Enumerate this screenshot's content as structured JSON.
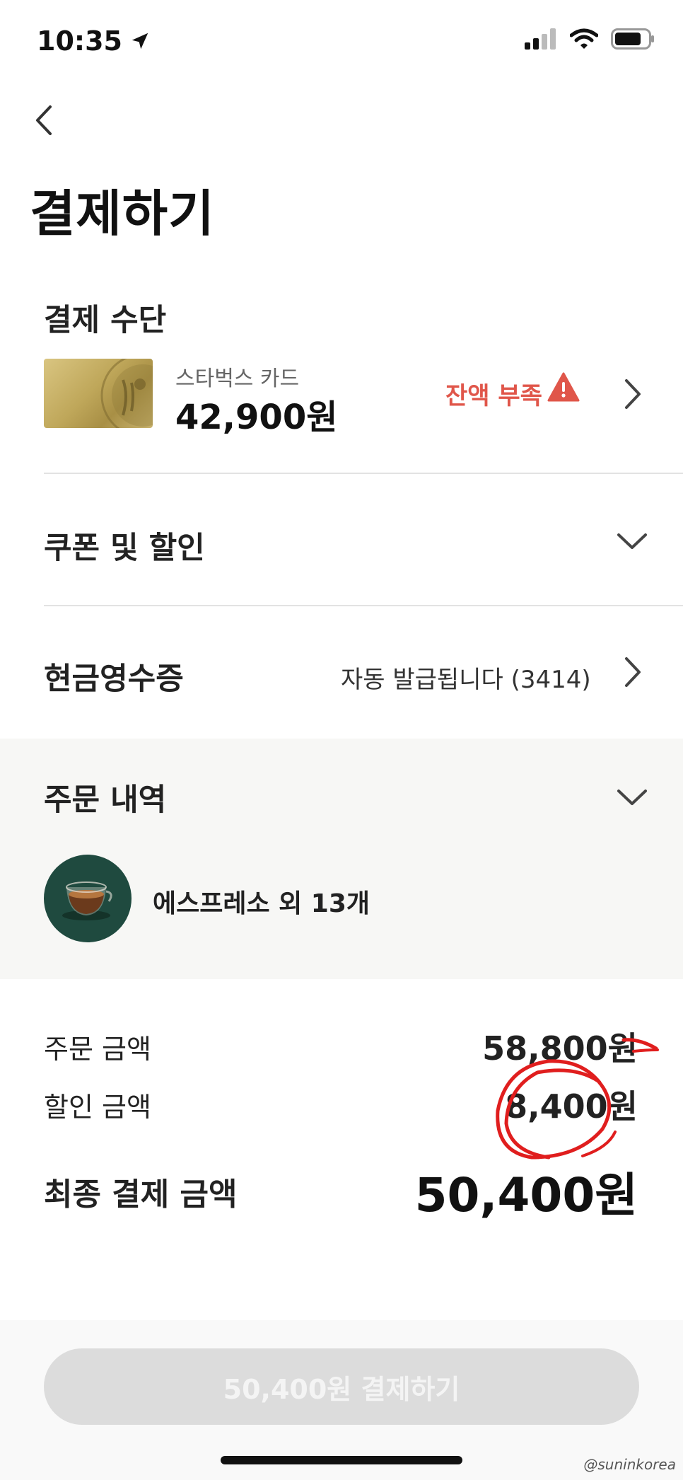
{
  "status_bar": {
    "time": "10:35"
  },
  "header": {
    "title": "결제하기"
  },
  "payment": {
    "section_title": "결제 수단",
    "card_name": "스타벅스 카드",
    "card_balance": "42,900원",
    "warning": "잔액 부족"
  },
  "coupon": {
    "label": "쿠폰 및 할인"
  },
  "receipt": {
    "label": "현금영수증",
    "value": "자동 발급됩니다 (3414)"
  },
  "order": {
    "section_title": "주문 내역",
    "item_label": "에스프레소 외 13개"
  },
  "summary": {
    "order_amount_label": "주문 금액",
    "order_amount": "58,800원",
    "discount_label": "할인 금액",
    "discount": "8,400원",
    "final_label": "최종 결제 금액",
    "final": "50,400원"
  },
  "pay_button": {
    "label": "50,400원 결제하기"
  },
  "watermark": "@suninkorea",
  "colors": {
    "warning": "#e0564a",
    "card_gold": "#c9b36e",
    "drink_bg": "#1f4a3f",
    "annotation_red": "#e01e1e"
  }
}
